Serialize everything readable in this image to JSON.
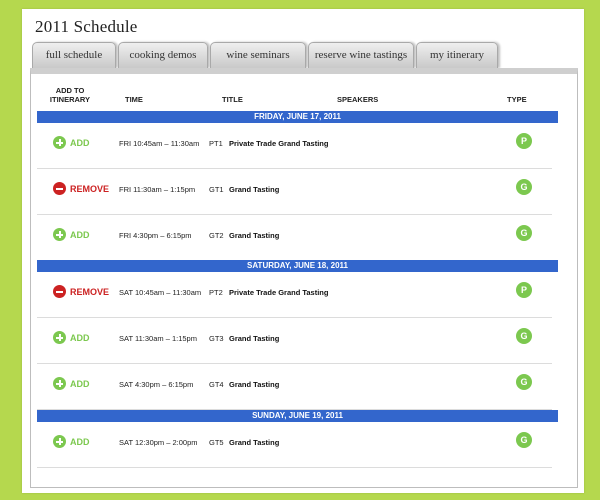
{
  "page": {
    "title": "2011 Schedule"
  },
  "tabs": [
    {
      "label": "full schedule"
    },
    {
      "label": "cooking demos"
    },
    {
      "label": "wine seminars"
    },
    {
      "label": "reserve wine tastings"
    },
    {
      "label": "my itinerary"
    }
  ],
  "columns": {
    "add_line1": "ADD TO",
    "add_line2": "ITINERARY",
    "time": "TIME",
    "title": "TITLE",
    "speakers": "SPEAKERS",
    "type": "TYPE"
  },
  "days": [
    {
      "label": "FRIDAY, JUNE 17, 2011"
    },
    {
      "label": "SATURDAY, JUNE 18, 2011"
    },
    {
      "label": "SUNDAY, JUNE 19, 2011"
    }
  ],
  "events": [
    {
      "action": "ADD",
      "time": "FRI 10:45am – 11:30am",
      "code": "PT1",
      "title": "Private Trade Grand Tasting",
      "type": "P"
    },
    {
      "action": "REMOVE",
      "time": "FRI 11:30am – 1:15pm",
      "code": "GT1",
      "title": "Grand Tasting",
      "type": "G"
    },
    {
      "action": "ADD",
      "time": "FRI 4:30pm – 6:15pm",
      "code": "GT2",
      "title": "Grand Tasting",
      "type": "G"
    },
    {
      "action": "REMOVE",
      "time": "SAT 10:45am – 11:30am",
      "code": "PT2",
      "title": "Private Trade Grand Tasting",
      "type": "P"
    },
    {
      "action": "ADD",
      "time": "SAT 11:30am – 1:15pm",
      "code": "GT3",
      "title": "Grand Tasting",
      "type": "G"
    },
    {
      "action": "ADD",
      "time": "SAT 4:30pm – 6:15pm",
      "code": "GT4",
      "title": "Grand Tasting",
      "type": "G"
    },
    {
      "action": "ADD",
      "time": "SAT 12:30pm – 2:00pm",
      "code": "GT5",
      "title": "Grand Tasting",
      "type": "G"
    }
  ],
  "colors": {
    "background": "#b5d84e",
    "day_bar": "#3366cc",
    "add": "#7cc84f",
    "remove": "#cc2222"
  }
}
